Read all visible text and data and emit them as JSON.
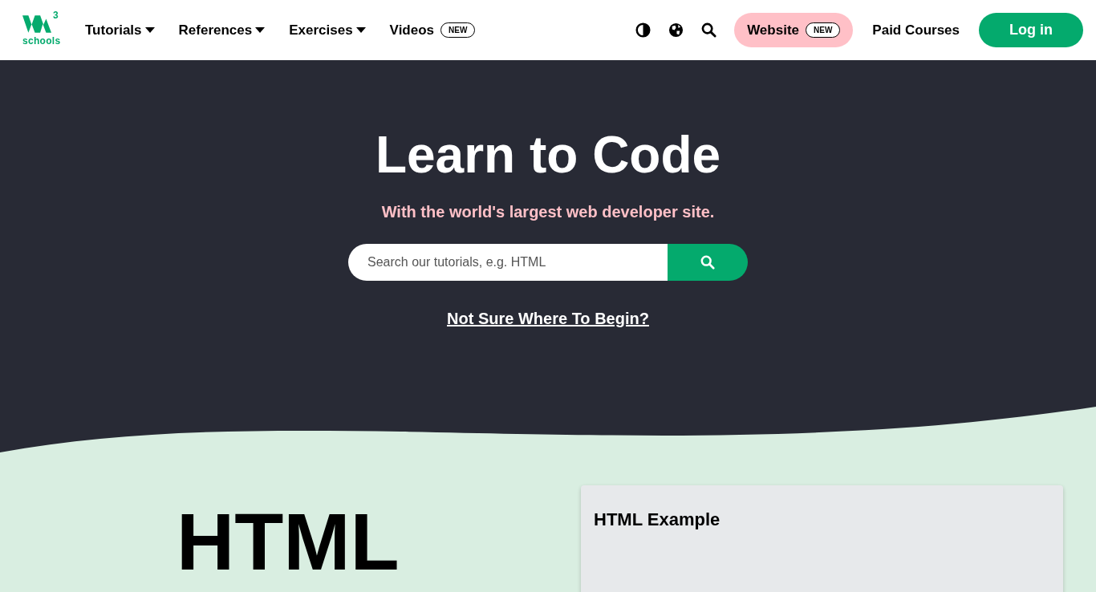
{
  "logo": {
    "superscript": "3",
    "text": "schools"
  },
  "nav": [
    {
      "kind": "dropdown",
      "label": "Tutorials"
    },
    {
      "kind": "dropdown",
      "label": "References"
    },
    {
      "kind": "dropdown",
      "label": "Exercises"
    },
    {
      "kind": "badge",
      "label": "Videos",
      "badge": "NEW"
    }
  ],
  "website_button": {
    "label": "Website",
    "badge": "NEW"
  },
  "paid_courses": "Paid Courses",
  "login_button": "Log in",
  "hero": {
    "title": "Learn to Code",
    "subtitle": "With the world's largest web developer site.",
    "search": {
      "placeholder": "Search our tutorials, e.g. HTML"
    },
    "link": "Not Sure Where To Begin?"
  },
  "section": {
    "heading": "HTML",
    "card_title": "HTML Example"
  }
}
